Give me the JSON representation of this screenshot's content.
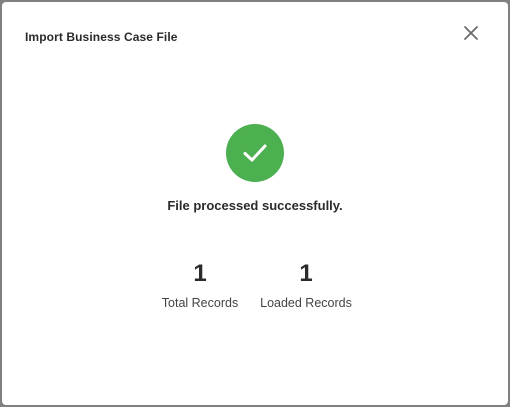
{
  "dialog": {
    "title": "Import Business Case File",
    "close_icon": "close-icon",
    "success_icon": "check-circle-icon",
    "message": "File processed successfully.",
    "accent_color": "#4caf50"
  },
  "stats": {
    "total": {
      "value": "1",
      "label": "Total Records"
    },
    "loaded": {
      "value": "1",
      "label": "Loaded Records"
    }
  }
}
